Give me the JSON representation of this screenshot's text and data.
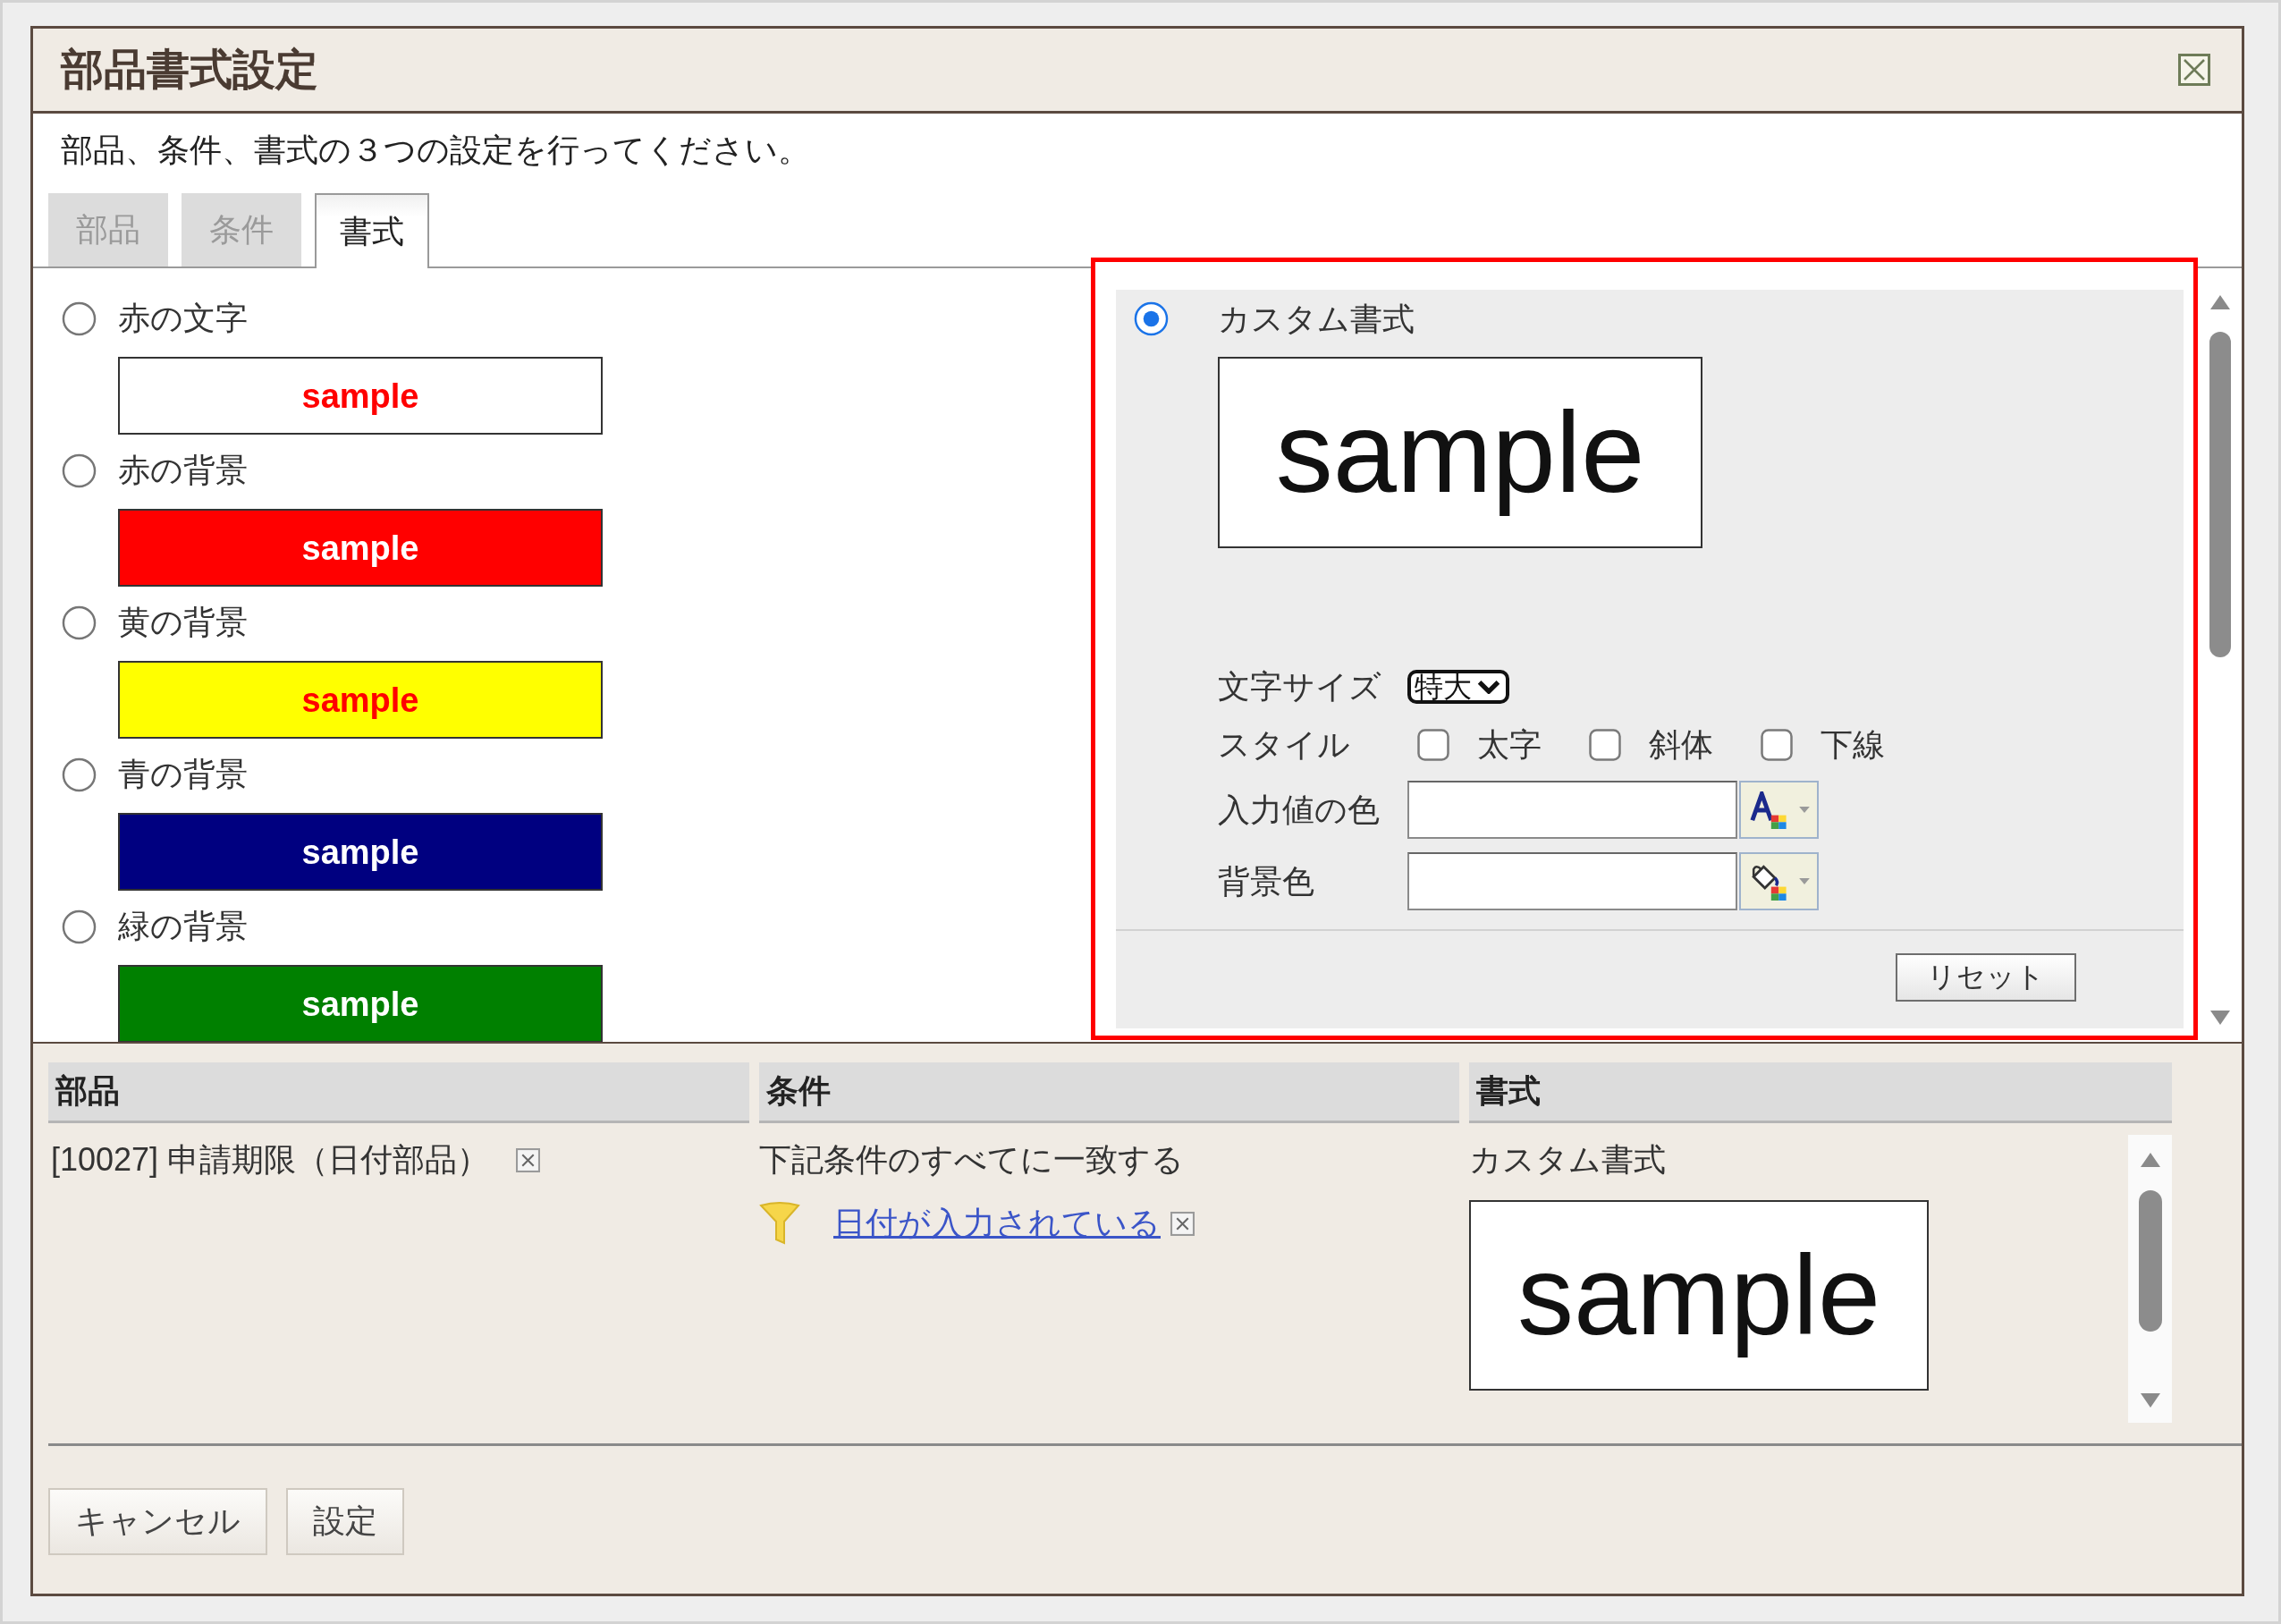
{
  "dialog": {
    "title": "部品書式設定",
    "instruction": "部品、条件、書式の３つの設定を行ってください。"
  },
  "tabs": [
    {
      "label": "部品",
      "selected": false
    },
    {
      "label": "条件",
      "selected": false
    },
    {
      "label": "書式",
      "selected": true
    }
  ],
  "format_presets": [
    {
      "label": "赤の文字",
      "selected": false,
      "color": "#ffffff",
      "sample": {
        "text": "sample",
        "color": "#ff0000"
      }
    },
    {
      "label": "赤の背景",
      "selected": false,
      "color": "#ff0000",
      "sample": {
        "text": "sample",
        "color": "#ffffff"
      }
    },
    {
      "label": "黄の背景",
      "selected": false,
      "color": "#ffff00",
      "sample": {
        "text": "sample",
        "color": "#ff0000"
      }
    },
    {
      "label": "青の背景",
      "selected": false,
      "color": "#000080",
      "sample": {
        "text": "sample",
        "color": "#ffffff"
      }
    },
    {
      "label": "緑の背景",
      "selected": false,
      "color": "#008000",
      "sample": {
        "text": "sample",
        "color": "#ffffff"
      }
    }
  ],
  "custom_format": {
    "label": "カスタム書式",
    "selected": true,
    "sample": "sample",
    "font_size": {
      "label": "文字サイズ",
      "value": "特大"
    },
    "style": {
      "label": "スタイル",
      "options": [
        {
          "label": "太字",
          "checked": false
        },
        {
          "label": "斜体",
          "checked": false
        },
        {
          "label": "下線",
          "checked": false
        }
      ]
    },
    "text_color": {
      "label": "入力値の色"
    },
    "background_color": {
      "label": "背景色"
    },
    "reset_button": "リセット"
  },
  "summary": {
    "columns": [
      "部品",
      "条件",
      "書式"
    ],
    "part": "[10027] 申請期限（日付部品）",
    "condition": {
      "match": "下記条件のすべてに一致する",
      "rules": [
        {
          "label": "日付が入力されている"
        }
      ]
    },
    "format": {
      "label": "カスタム書式",
      "sample": "sample"
    }
  },
  "buttons": [
    "キャンセル",
    "設定"
  ]
}
